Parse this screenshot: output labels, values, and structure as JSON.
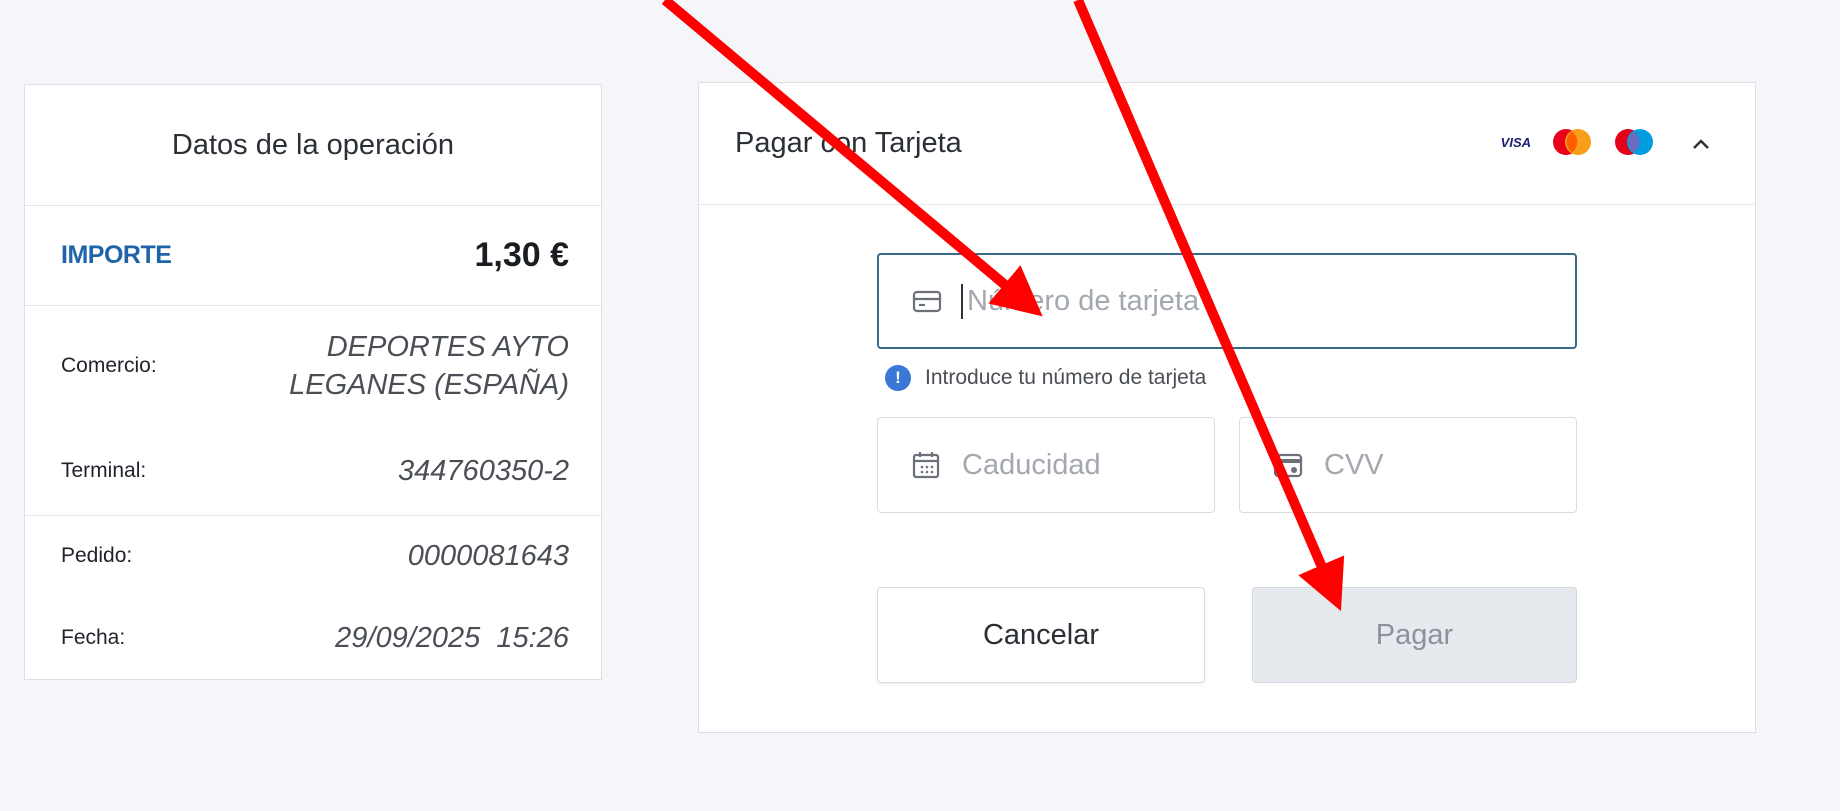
{
  "operation": {
    "title": "Datos de la operación",
    "importe_label": "IMPORTE",
    "importe_value": "1,30 €",
    "rows": {
      "comercio": {
        "label": "Comercio:",
        "value_line1": "DEPORTES AYTO",
        "value_line2": "LEGANES (ESPAÑA)"
      },
      "terminal": {
        "label": "Terminal:",
        "value": "344760350-2"
      },
      "pedido": {
        "label": "Pedido:",
        "value": "0000081643"
      },
      "fecha": {
        "label": "Fecha:",
        "value": "29/09/2025  15:26"
      }
    }
  },
  "payment": {
    "title": "Pagar con Tarjeta",
    "brands": {
      "visa": "VISA"
    },
    "card_number_placeholder": "Número de tarjeta",
    "card_hint": "Introduce tu número de tarjeta",
    "expiry_placeholder": "Caducidad",
    "cvv_placeholder": "CVV",
    "cancel_label": "Cancelar",
    "pay_label": "Pagar"
  },
  "colors": {
    "importe_label": "#1f64a8",
    "focused_border": "#3a6a8a",
    "annotation_arrow": "#ff0000",
    "info_icon": "#3a77d6"
  },
  "icons": {
    "card_field": "credit-card-icon",
    "expiry_field": "calendar-icon",
    "cvv_field": "card-cvv-icon",
    "hint": "info-icon",
    "collapse": "chevron-up-icon"
  }
}
